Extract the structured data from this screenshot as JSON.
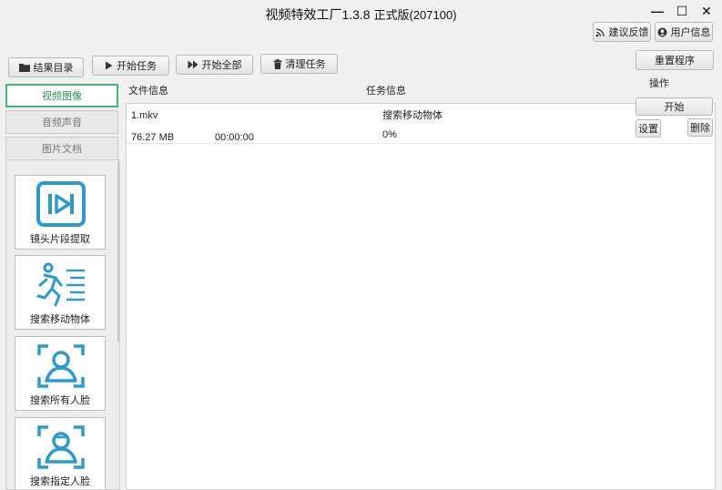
{
  "app": {
    "title": "视频特效工厂1.3.8",
    "version_label": "正式版(207100)"
  },
  "window_controls": {
    "minimize": "—",
    "maximize": "☐",
    "close": "✕"
  },
  "header_buttons": {
    "feedback": "建议反馈",
    "user_info": "用户信息",
    "restart": "重置程序"
  },
  "toolbar": {
    "results_dir": "结果目录",
    "start_task": "开始任务",
    "start_all": "开始全部",
    "clear_tasks": "清理任务"
  },
  "category_tabs": [
    {
      "label": "视频图像",
      "active": true
    },
    {
      "label": "音频声音",
      "active": false
    },
    {
      "label": "图片文档",
      "active": false
    }
  ],
  "tools": [
    {
      "label": "镜头片段提取",
      "icon": "video-clip-icon"
    },
    {
      "label": "搜索移动物体",
      "icon": "running-person-icon"
    },
    {
      "label": "搜索所有人脸",
      "icon": "face-scan-icon"
    },
    {
      "label": "搜索指定人脸",
      "icon": "specific-face-scan-icon"
    }
  ],
  "table": {
    "headers": {
      "file_info": "文件信息",
      "task_info": "任务信息",
      "actions": "操作"
    },
    "rows": [
      {
        "file_name": "1.mkv",
        "size": "76.27 MB",
        "duration": "00:00:00",
        "task_name": "搜索移动物体",
        "progress": "0%",
        "start_label": "开始",
        "settings_label": "设置",
        "delete_label": "删除"
      }
    ]
  },
  "colors": {
    "accent": "#2b9ad1",
    "active_tab_border": "#46b478",
    "active_tab_text": "#2e8f57"
  }
}
